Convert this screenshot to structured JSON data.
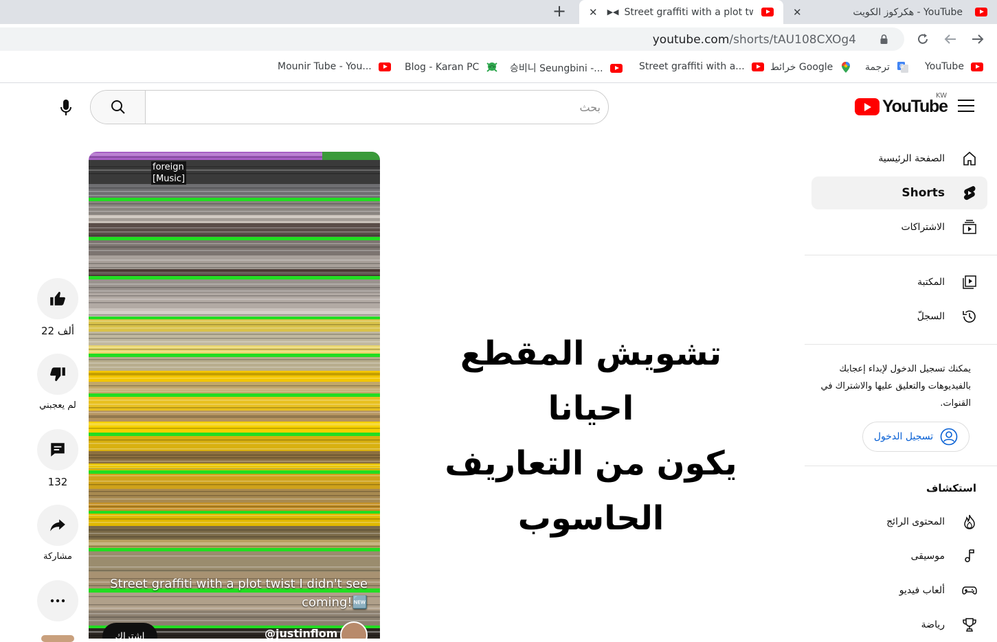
{
  "browser": {
    "tabs": [
      {
        "title": "هكركوز الكويت - YouTube"
      },
      {
        "title": "Street graffiti with a plot twis"
      }
    ],
    "url_host": "youtube.com",
    "url_path": "/shorts/tAU108CXOg4",
    "bookmarks": [
      {
        "label": "YouTube"
      },
      {
        "label": "ترجمة"
      },
      {
        "label": "خرائط Google"
      },
      {
        "label": "Street graffiti with a..."
      },
      {
        "label": "승비니 Seungbini -..."
      },
      {
        "label": "Blog - Karan PC"
      },
      {
        "label": "Mounir Tube - You..."
      }
    ]
  },
  "header": {
    "logo_text": "YouTube",
    "country_code": "KW",
    "search_placeholder": "بحث"
  },
  "sidebar": {
    "main": [
      {
        "label": "الصفحة الرئيسية",
        "icon": "home-icon"
      },
      {
        "label": "Shorts",
        "icon": "shorts-icon"
      },
      {
        "label": "الاشتراكات",
        "icon": "subscriptions-icon"
      }
    ],
    "library": [
      {
        "label": "المكتبة",
        "icon": "library-icon"
      },
      {
        "label": "السجلّ",
        "icon": "history-icon"
      }
    ],
    "signin_text": "يمكنك تسجيل الدخول لإبداء إعجابك بالفيديوهات والتعليق عليها والاشتراك في القنوات.",
    "signin_label": "تسجيل الدخول",
    "explore_heading": "استكشاف",
    "explore": [
      {
        "label": "المحتوى الرائج",
        "icon": "trending-icon"
      },
      {
        "label": "موسيقى",
        "icon": "music-icon"
      },
      {
        "label": "ألعاب فيديو",
        "icon": "gaming-icon"
      },
      {
        "label": "رياضة",
        "icon": "trophy-icon"
      }
    ]
  },
  "short": {
    "caption": [
      "foreign",
      "[Music]"
    ],
    "title": "Street graffiti with a plot twist I didn't see coming!🆕",
    "channel": "@justinflom",
    "subscribe_label": "اشتراك",
    "likes": "22 ألف",
    "dislike_label": "لم يعجبني",
    "comments": "132",
    "share_label": "مشاركة"
  },
  "overlay_note": [
    "تشويش المقطع احيانا",
    "يكون من التعاريف الحاسوب"
  ],
  "colors": {
    "brand_red": "#ff0000",
    "link_blue": "#065fd4",
    "glitch_green": "#22dd22",
    "glitch_yellow": "#f2c500"
  }
}
